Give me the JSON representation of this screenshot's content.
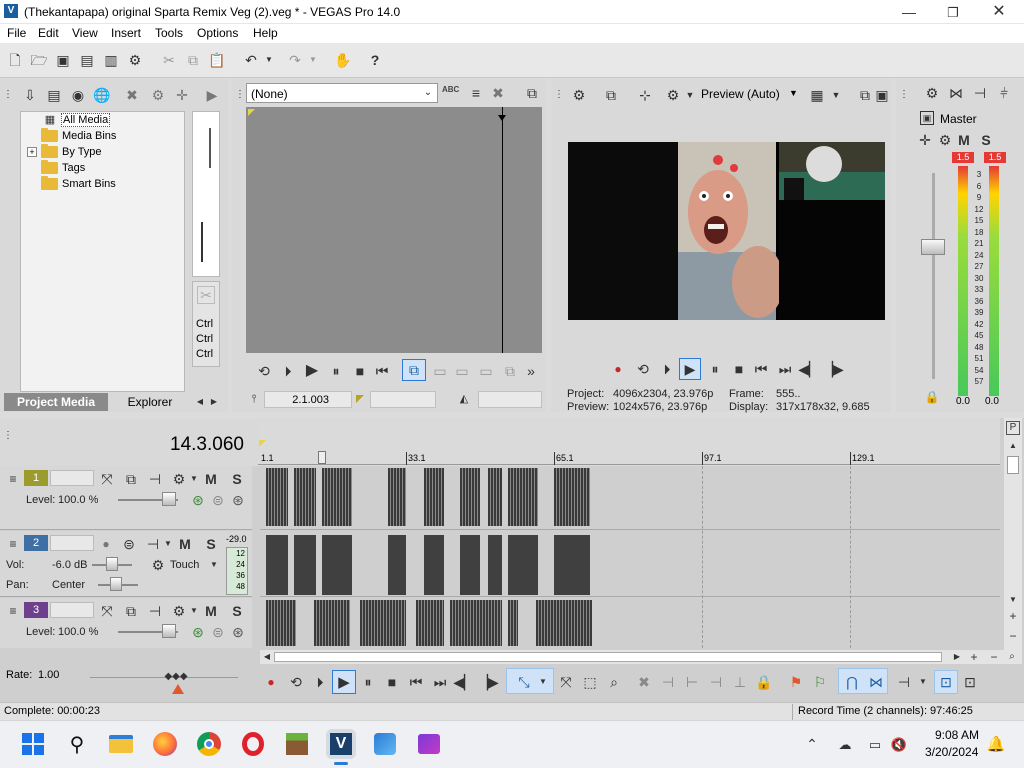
{
  "window": {
    "title": "(Thekantapapa) original Sparta Remix Veg (2).veg * - VEGAS Pro 14.0"
  },
  "menu": [
    "File",
    "Edit",
    "View",
    "Insert",
    "Tools",
    "Options",
    "Help"
  ],
  "project_media": {
    "tree": [
      {
        "label": "All Media",
        "expander": ""
      },
      {
        "label": "Media Bins",
        "expander": ""
      },
      {
        "label": "By Type",
        "expander": "+"
      },
      {
        "label": "Tags",
        "expander": ""
      },
      {
        "label": "Smart Bins",
        "expander": ""
      }
    ],
    "tabs": [
      "Project Media",
      "Explorer"
    ],
    "ctrl_labels": [
      "Ctrl",
      "Ctrl",
      "Ctrl"
    ]
  },
  "trimmer": {
    "dropdown_value": "(None)",
    "abc_label": "ABC",
    "timecode": "2.1.003"
  },
  "preview": {
    "quality": "Preview (Auto)",
    "project_label": "Project:",
    "project_value": "4096x2304, 23.976p",
    "preview_label": "Preview:",
    "preview_value": "1024x576, 23.976p",
    "frame_label": "Frame:",
    "frame_value": "555..",
    "display_label": "Display:",
    "display_value": "317x178x32, 9.685"
  },
  "master": {
    "label": "Master",
    "m_label": "M",
    "s_label": "S",
    "peak_left": "1.5",
    "peak_right": "1.5",
    "ticks": [
      "3",
      "6",
      "9",
      "12",
      "15",
      "18",
      "21",
      "24",
      "27",
      "30",
      "33",
      "36",
      "39",
      "42",
      "45",
      "48",
      "51",
      "54",
      "57"
    ],
    "level_left": "0.0",
    "level_right": "0.0"
  },
  "timeline": {
    "timecode": "14.3.060",
    "ruler": [
      "1.1",
      "33.1",
      "65.1",
      "97.1",
      "129.1"
    ],
    "tracks": [
      {
        "num": "1",
        "level_label": "Level:",
        "level_value": "100.0 %"
      },
      {
        "num": "2",
        "vol_label": "Vol:",
        "vol_value": "-6.0 dB",
        "pan_label": "Pan:",
        "pan_value": "Center",
        "mode": "Touch",
        "meter_top": "-29.0",
        "meter_ticks": [
          "12",
          "24",
          "36",
          "48"
        ]
      },
      {
        "num": "3",
        "level_label": "Level:",
        "level_value": "100.0 %"
      }
    ],
    "m_label": "M",
    "s_label": "S"
  },
  "rate": {
    "label": "Rate:",
    "value": "1.00"
  },
  "status": {
    "left": "Complete: 00:00:23",
    "right": "Record Time (2 channels): 97:46:25"
  },
  "taskbar": {
    "time": "9:08 AM",
    "date": "3/20/2024"
  },
  "colors": {
    "track1": "#9c9c2e",
    "track2": "#3f6fa5",
    "track3": "#6d3f8c",
    "accent": "#2b7bd6"
  }
}
